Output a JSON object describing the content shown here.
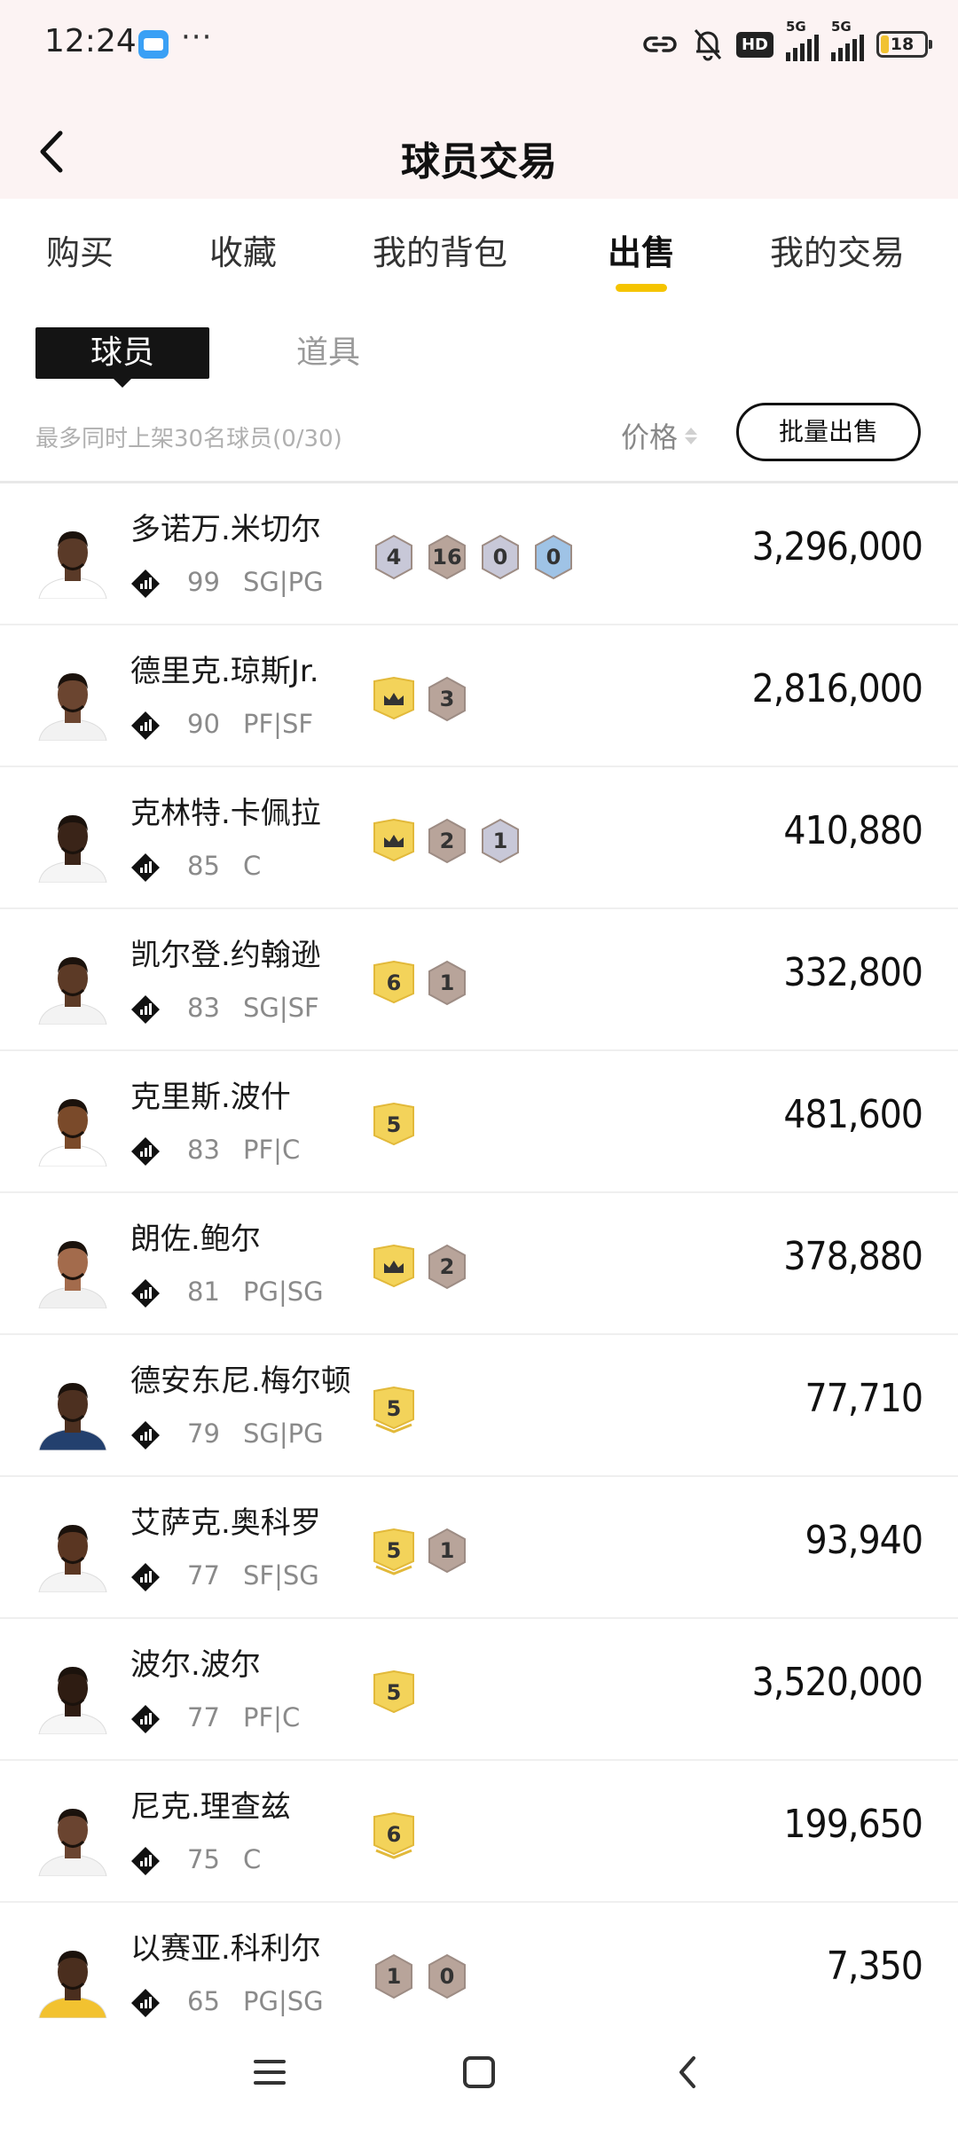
{
  "status_bar": {
    "time": "12:24",
    "more": "···",
    "hd_label": "HD",
    "signal1_label": "5G",
    "signal2_label": "5G",
    "battery_text": "18",
    "battery_level": 0.18
  },
  "header": {
    "title": "球员交易"
  },
  "main_tabs": [
    {
      "label": "购买"
    },
    {
      "label": "收藏"
    },
    {
      "label": "我的背包"
    },
    {
      "label": "出售",
      "active": true
    },
    {
      "label": "我的交易"
    }
  ],
  "sub_tabs": [
    {
      "label": "球员",
      "active": true
    },
    {
      "label": "道具"
    }
  ],
  "toolbar": {
    "limit_text": "最多同时上架30名球员(0/30)",
    "price_sort_label": "价格",
    "bulk_sell_label": "批量出售"
  },
  "players": [
    {
      "name": "多诺万.米切尔",
      "rating": "99",
      "position": "SG|PG",
      "price": "3,296,000",
      "badges": [
        {
          "type": "silver",
          "text": "4"
        },
        {
          "type": "bronze",
          "text": "16"
        },
        {
          "type": "silver",
          "text": "0"
        },
        {
          "type": "blue",
          "text": "0"
        }
      ],
      "skin": "#5a3a28",
      "jersey": "#ffffff"
    },
    {
      "name": "德里克.琼斯Jr.",
      "rating": "90",
      "position": "PF|SF",
      "price": "2,816,000",
      "badges": [
        {
          "type": "crown"
        },
        {
          "type": "bronze",
          "text": "3"
        }
      ],
      "skin": "#6b4530",
      "jersey": "#f2f2f2"
    },
    {
      "name": "克林特.卡佩拉",
      "rating": "85",
      "position": "C",
      "price": "410,880",
      "badges": [
        {
          "type": "crown"
        },
        {
          "type": "bronze",
          "text": "2"
        },
        {
          "type": "silver",
          "text": "1"
        }
      ],
      "skin": "#3a2418",
      "jersey": "#f5f5f5"
    },
    {
      "name": "凯尔登.约翰逊",
      "rating": "83",
      "position": "SG|SF",
      "price": "332,800",
      "badges": [
        {
          "type": "gold",
          "text": "6"
        },
        {
          "type": "bronze",
          "text": "1"
        }
      ],
      "skin": "#5c3a26",
      "jersey": "#f3f3f3"
    },
    {
      "name": "克里斯.波什",
      "rating": "83",
      "position": "PF|C",
      "price": "481,600",
      "badges": [
        {
          "type": "gold",
          "text": "5"
        }
      ],
      "skin": "#7a4a2a",
      "jersey": "#ffffff"
    },
    {
      "name": "朗佐.鲍尔",
      "rating": "81",
      "position": "PG|SG",
      "price": "378,880",
      "badges": [
        {
          "type": "crown"
        },
        {
          "type": "bronze",
          "text": "2"
        }
      ],
      "skin": "#a36b4c",
      "jersey": "#f0f0f0"
    },
    {
      "name": "德安东尼.梅尔顿",
      "rating": "79",
      "position": "SG|PG",
      "price": "77,710",
      "badges": [
        {
          "type": "gold2",
          "text": "5"
        }
      ],
      "skin": "#4d3020",
      "jersey": "#23406e"
    },
    {
      "name": "艾萨克.奥科罗",
      "rating": "77",
      "position": "SF|SG",
      "price": "93,940",
      "badges": [
        {
          "type": "gold2",
          "text": "5"
        },
        {
          "type": "bronze",
          "text": "1"
        }
      ],
      "skin": "#5a3622",
      "jersey": "#f4f4f4"
    },
    {
      "name": "波尔.波尔",
      "rating": "77",
      "position": "PF|C",
      "price": "3,520,000",
      "badges": [
        {
          "type": "gold",
          "text": "5"
        }
      ],
      "skin": "#2e1c12",
      "jersey": "#f6f6f6"
    },
    {
      "name": "尼克.理查兹",
      "rating": "75",
      "position": "C",
      "price": "199,650",
      "badges": [
        {
          "type": "gold2",
          "text": "6"
        }
      ],
      "skin": "#6a4430",
      "jersey": "#f3f3f3"
    },
    {
      "name": "以赛亚.科利尔",
      "rating": "65",
      "position": "PG|SG",
      "price": "7,350",
      "badges": [
        {
          "type": "bronze",
          "text": "1"
        },
        {
          "type": "bronze",
          "text": "0"
        }
      ],
      "skin": "#4a2e1e",
      "jersey": "#f2c230"
    }
  ],
  "colors": {
    "accent": "#f5c400",
    "header_bg": "#fcf3f3",
    "gold_badge": "#f3d35a",
    "bronze_badge": "#b8a49a",
    "silver_badge": "#c8c8d8",
    "blue_badge": "#9fc3e6"
  },
  "nav_bar": {
    "menu_icon": "menu-icon",
    "home_icon": "home-icon",
    "back_icon": "back-icon"
  }
}
